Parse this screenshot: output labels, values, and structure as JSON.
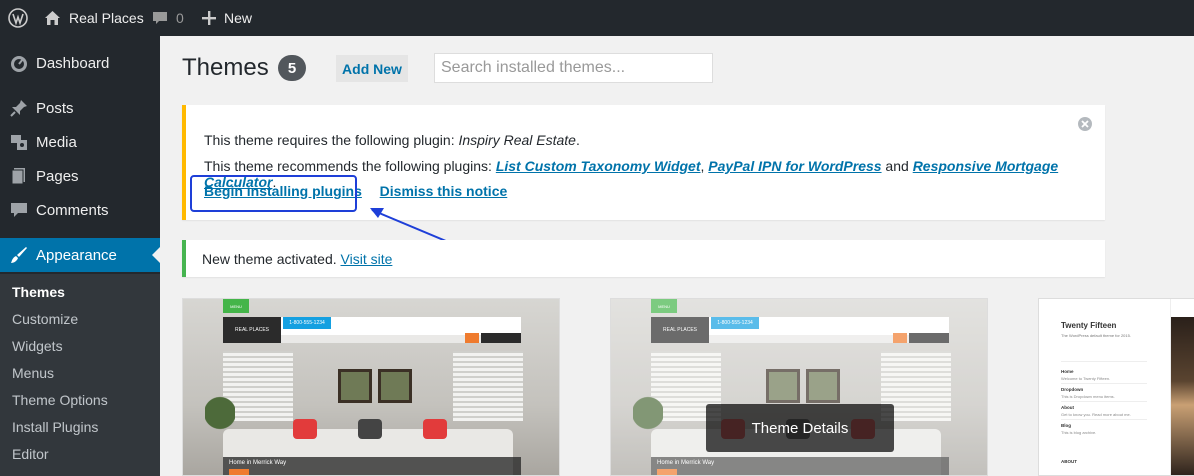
{
  "adminbar": {
    "site_name": "Real Places",
    "comment_count": "0",
    "new_label": "New"
  },
  "sidebar": {
    "items": [
      {
        "label": "Dashboard",
        "icon": "dashboard-icon"
      },
      {
        "label": "Posts",
        "icon": "pin-icon"
      },
      {
        "label": "Media",
        "icon": "media-icon"
      },
      {
        "label": "Pages",
        "icon": "pages-icon"
      },
      {
        "label": "Comments",
        "icon": "comment-icon"
      },
      {
        "label": "Appearance",
        "icon": "brush-icon",
        "current": true
      }
    ],
    "submenu": [
      "Themes",
      "Customize",
      "Widgets",
      "Menus",
      "Theme Options",
      "Install Plugins",
      "Editor"
    ]
  },
  "main": {
    "title": "Themes",
    "count": "5",
    "add_new_label": "Add New",
    "search_placeholder": "Search installed themes..."
  },
  "plugin_notice": {
    "required_prefix": "This theme requires the following plugin: ",
    "required_plugin": "Inspiry Real Estate",
    "required_suffix": ".",
    "recommends_prefix": "This theme recommends the following plugins: ",
    "recommended_1": "List Custom Taxonomy Widget",
    "sep_1": ", ",
    "recommended_2": "PayPal IPN for WordPress",
    "sep_2": " and ",
    "recommended_3": "Responsive Mortgage Calculator",
    "recommends_suffix": ".",
    "begin_installing": "Begin installing plugins",
    "dismiss": "Dismiss this notice"
  },
  "activated_notice": {
    "text": "New theme activated. ",
    "visit_site": "Visit site"
  },
  "themes": {
    "details_label": "Theme Details",
    "card1": {
      "menu_tab": "MENU",
      "logo_text": "REAL PLACES",
      "phone": "1-800-555-1234",
      "caption": "Home in Merrick Way"
    },
    "card2": {
      "menu_tab": "MENU",
      "logo_text": "REAL PLACES",
      "phone": "1-800-555-1234",
      "caption": "Home in Merrick Way"
    },
    "card3": {
      "title": "Twenty Fifteen",
      "tagline": "The WordPress default theme for 2015.",
      "menu_home": "Home",
      "menu_home_sub": "Welcome to Twenty Fifteen.",
      "menu_dropdown": "Dropdown",
      "menu_dropdown_sub": "This is Dropdown menu items.",
      "menu_about": "About",
      "menu_about_sub": "Get to know you. Read more about me.",
      "menu_blog": "Blog",
      "menu_blog_sub": "This is blog archive.",
      "about_heading": "ABOUT"
    }
  },
  "colors": {
    "admin_dark": "#23282d",
    "accent_blue": "#0073aa",
    "warning_yellow": "#ffb900",
    "success_green": "#46b450",
    "annotation_blue": "#1e3fd8"
  }
}
